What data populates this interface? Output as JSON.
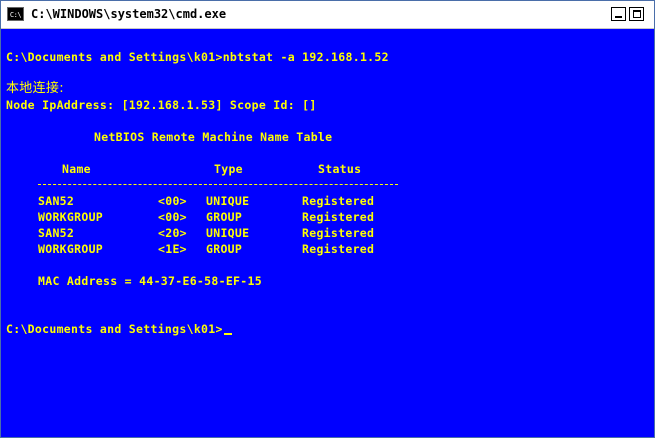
{
  "window": {
    "title": "C:\\WINDOWS\\system32\\cmd.exe",
    "icon_label": "C:\\",
    "minimize_label": "_",
    "maximize_label": "□"
  },
  "console": {
    "command_line": "C:\\Documents and Settings\\k01>nbtstat -a 192.168.1.52",
    "adapter_label": "本地连接:",
    "node_line": "Node IpAddress: [192.168.1.53] Scope Id: []",
    "table_title": "NetBIOS Remote Machine Name Table",
    "columns": {
      "name": "Name",
      "type": "Type",
      "status": "Status"
    },
    "rows": [
      {
        "name": "SAN52",
        "code": "<00>",
        "type": "UNIQUE",
        "status": "Registered"
      },
      {
        "name": "WORKGROUP",
        "code": "<00>",
        "type": "GROUP",
        "status": "Registered"
      },
      {
        "name": "SAN52",
        "code": "<20>",
        "type": "UNIQUE",
        "status": "Registered"
      },
      {
        "name": "WORKGROUP",
        "code": "<1E>",
        "type": "GROUP",
        "status": "Registered"
      }
    ],
    "mac_line": "MAC Address = 44-37-E6-58-EF-15",
    "prompt_line": "C:\\Documents and Settings\\k01>"
  },
  "colors": {
    "console_background": "#0000ff",
    "console_text": "#ffff00"
  }
}
